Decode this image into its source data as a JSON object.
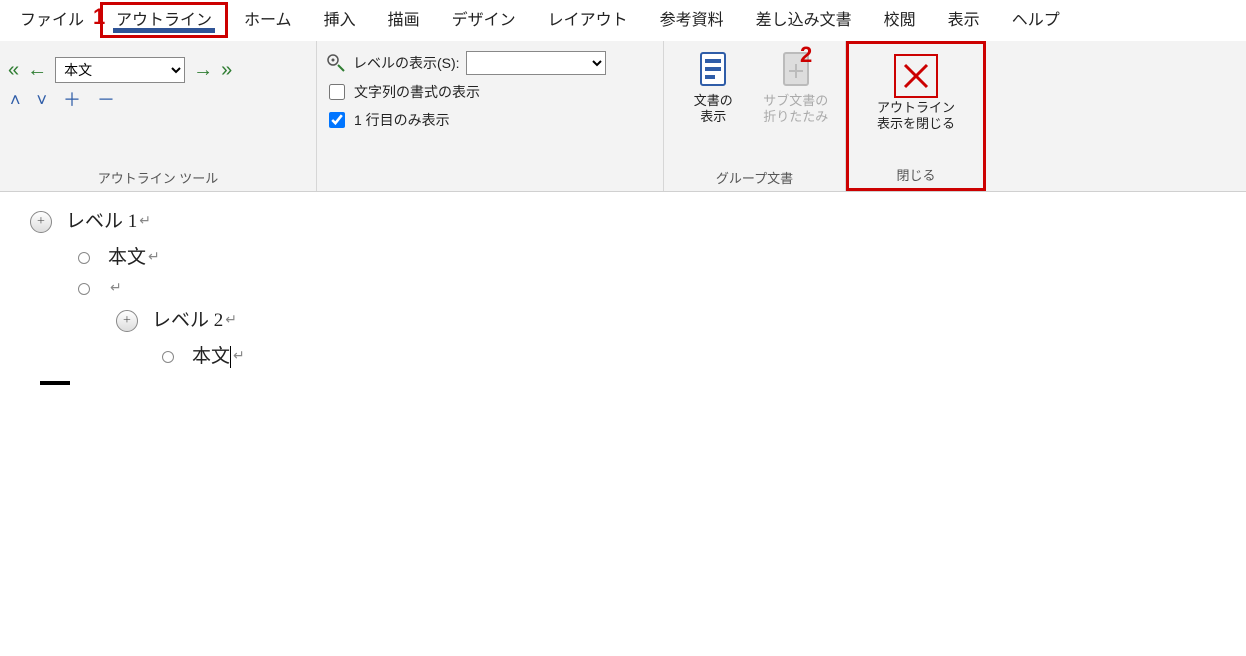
{
  "menu": {
    "file": "ファイル",
    "outline": "アウトライン",
    "home": "ホーム",
    "insert": "挿入",
    "draw": "描画",
    "design": "デザイン",
    "layout": "レイアウト",
    "references": "参考資料",
    "mailings": "差し込み文書",
    "review": "校閲",
    "view": "表示",
    "help": "ヘルプ"
  },
  "annotations": {
    "one": "1",
    "two": "2"
  },
  "outline_tools": {
    "level_select": "本文",
    "group_label": "アウトライン ツール"
  },
  "show": {
    "show_level_label": "レベルの表示(S):",
    "show_level_value": "",
    "show_formatting": "文字列の書式の表示",
    "first_line_only": "1 行目のみ表示"
  },
  "master": {
    "show_doc_l1": "文書の",
    "show_doc_l2": "表示",
    "collapse_l1": "サブ文書の",
    "collapse_l2": "折りたたみ",
    "group_label": "グループ文書"
  },
  "close": {
    "line1": "アウトライン",
    "line2": "表示を閉じる",
    "group_label": "閉じる"
  },
  "doc": {
    "l1": "レベル 1",
    "body1": "本文",
    "l2": "レベル 2",
    "body2": "本文"
  }
}
